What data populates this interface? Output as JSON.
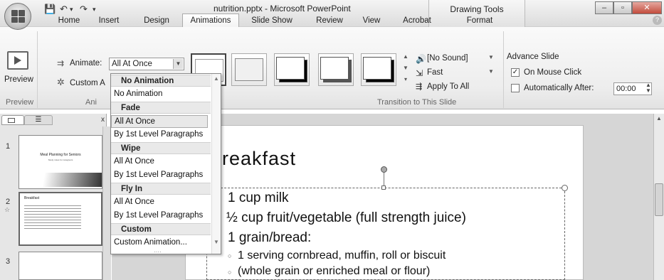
{
  "window": {
    "title": "nutrition.pptx - Microsoft PowerPoint",
    "contextual_tab_group": "Drawing Tools",
    "minimize": "–",
    "restore": "▫",
    "close": "✕"
  },
  "quick_access": {
    "save": "💾",
    "undo": "↶",
    "undo_arrow": "▾",
    "redo": "↷",
    "customize": "▾"
  },
  "tabs": [
    "Home",
    "Insert",
    "Design",
    "Animations",
    "Slide Show",
    "Review",
    "View",
    "Acrobat",
    "Format"
  ],
  "active_tab": "Animations",
  "help": "?",
  "ribbon": {
    "preview_label": "Preview",
    "preview_group": "Preview",
    "animate_label": "Animate:",
    "animate_value": "All At Once",
    "custom_anim_label": "Custom A",
    "animations_group": "Ani",
    "sound_value": "[No Sound]",
    "speed_value": "Fast",
    "apply_to_all": "Apply To All",
    "transition_group": "Transition to This Slide",
    "advance_slide": "Advance Slide",
    "on_mouse_click": "On Mouse Click",
    "on_mouse_click_checked": true,
    "auto_after": "Automatically After:",
    "auto_after_value": "00:00",
    "auto_after_checked": false
  },
  "dropdown": {
    "sections": [
      {
        "header": "No Animation",
        "items": [
          "No Animation"
        ]
      },
      {
        "header": "Fade",
        "items": [
          "All At Once",
          "By 1st Level Paragraphs"
        ]
      },
      {
        "header": "Wipe",
        "items": [
          "All At Once",
          "By 1st Level Paragraphs"
        ]
      },
      {
        "header": "Fly In",
        "items": [
          "All At Once",
          "By 1st Level Paragraphs"
        ]
      },
      {
        "header": "Custom",
        "items": [
          "Custom Animation..."
        ]
      }
    ],
    "selected": "All At Once",
    "resize_grip": "····"
  },
  "left_pane": {
    "close": "x",
    "slides": [
      {
        "number": "1",
        "title": "Meal Planning for Seniors",
        "subtitle": "Study notes for caregivers"
      },
      {
        "number": "2",
        "title": "Breakfast"
      },
      {
        "number": "3"
      }
    ]
  },
  "slide": {
    "title": "reakfast",
    "bullets": [
      "1 cup milk",
      "½ cup fruit/vegetable (full strength juice)",
      "1 grain/bread:"
    ],
    "sub_bullets": [
      "1 serving cornbread, muffin, roll or biscuit",
      "(whole grain or enriched meal or flour)"
    ]
  }
}
